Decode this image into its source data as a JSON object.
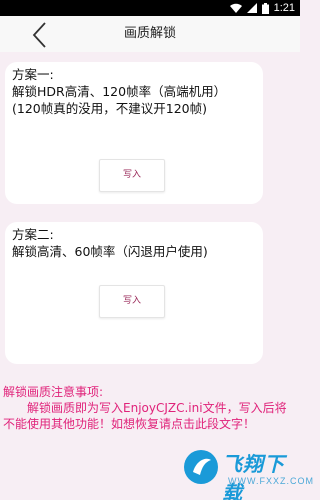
{
  "status_bar": {
    "time": "1:21"
  },
  "header": {
    "title": "画质解锁"
  },
  "plans": [
    {
      "text": "方案一:\n解锁HDR高清、120帧率（高端机用）\n(120帧真的没用，不建议开120帧)",
      "button_label": "写入"
    },
    {
      "text": "方案二:\n解锁高清、60帧率（闪退用户使用)",
      "button_label": "写入"
    }
  ],
  "notice": {
    "title": "解锁画质注意事项:",
    "body": "　　解锁画质即为写入EnjoyCJZC.ini文件，写入后将不能使用其他功能！如想恢复请点击此段文字！"
  },
  "watermark": {
    "title": "飞翔下载",
    "url": "WWW.FXXZ.COM"
  },
  "colors": {
    "accent_pink": "#e0237a",
    "button_text": "#9a2a5a",
    "background": "#f7eef4"
  }
}
